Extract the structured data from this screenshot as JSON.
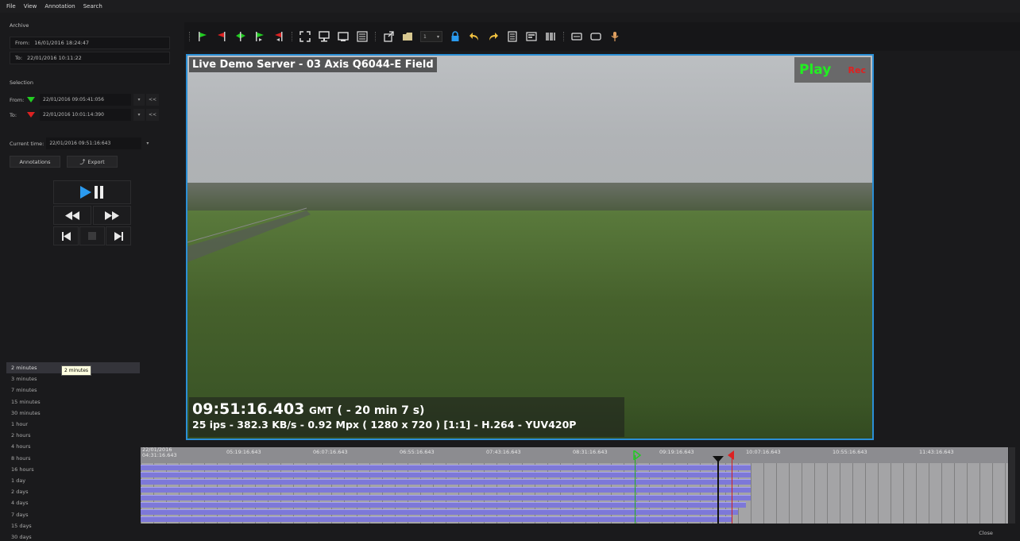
{
  "menu": [
    "File",
    "View",
    "Annotation",
    "Search"
  ],
  "archive": {
    "label": "Archive",
    "from_label": "From:",
    "from_value": "16/01/2016 18:24:47",
    "to_label": "To:",
    "to_value": "22/01/2016 10:11:22"
  },
  "selection": {
    "label": "Selection",
    "from_label": "From:",
    "from_value": "22/01/2016 09:05:41:056",
    "to_label": "To:",
    "to_value": "22/01/2016 10:01:14:390",
    "back_label": "<<"
  },
  "current_time": {
    "label": "Current time:",
    "value": "22/01/2016 09:51:16:643"
  },
  "buttons": {
    "annotations": "Annotations",
    "export": "Export"
  },
  "durations": [
    "2 minutes",
    "3 minutes",
    "7 minutes",
    "15 minutes",
    "30 minutes",
    "1 hour",
    "2 hours",
    "4 hours",
    "8 hours",
    "16 hours",
    "1 day",
    "2 days",
    "4 days",
    "7 days",
    "15 days",
    "30 days"
  ],
  "tooltip": "2 minutes",
  "toolbar": {
    "page_value": "1"
  },
  "video": {
    "title": "Live Demo Server - 03 Axis Q6044-E Field",
    "play": "Play",
    "rec": "Rec",
    "time": "09:51:16.403",
    "tz": "GMT",
    "offset": "( - 20 min 7 s)",
    "info": "25 ips  -  382.3 KB/s  -  0.92 Mpx  ( 1280 x 720 ) [1:1] -  H.264  -  YUV420P"
  },
  "timeline": {
    "first_label_date": "22/01/2016",
    "first_label_time": "04:31:16.643",
    "labels": [
      "05:19:16.643",
      "06:07:16.643",
      "06:55:16.643",
      "07:43:16.643",
      "08:31:16.643",
      "09:19:16.643",
      "10:07:16.643",
      "10:55:16.643",
      "11:43:16.643"
    ],
    "tracks": [
      0.7035,
      0.7035,
      0.7035,
      0.7035,
      0.7035,
      0.6978,
      0.6886,
      0.6813
    ]
  },
  "close": "Close",
  "colors": {
    "accent": "#2b8fd6",
    "play": "#22ee22",
    "rec": "#e02020",
    "track": "#7d78d8"
  }
}
